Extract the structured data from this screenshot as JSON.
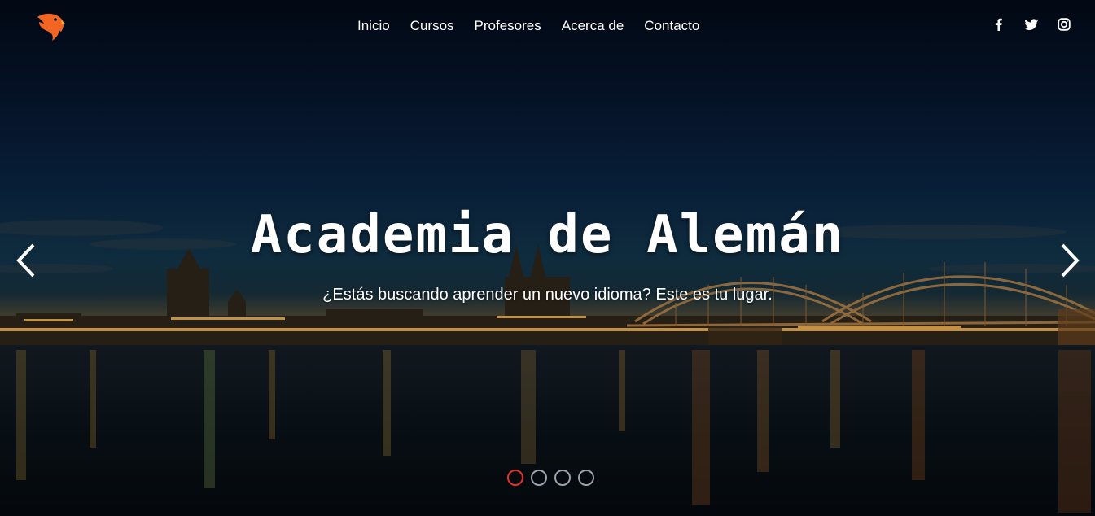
{
  "nav": {
    "items": [
      {
        "label": "Inicio"
      },
      {
        "label": "Cursos"
      },
      {
        "label": "Profesores"
      },
      {
        "label": "Acerca de"
      },
      {
        "label": "Contacto"
      }
    ]
  },
  "social": [
    "facebook-icon",
    "twitter-icon",
    "instagram-icon"
  ],
  "hero": {
    "title": "Academia de Alemán",
    "subtitle": "¿Estás buscando aprender un nuevo idioma? Este es tu lugar."
  },
  "carousel": {
    "slide_count": 4,
    "active_index": 0,
    "active_color": "#e2332a"
  },
  "colors": {
    "logo": "#f26522",
    "text": "#ffffff"
  }
}
